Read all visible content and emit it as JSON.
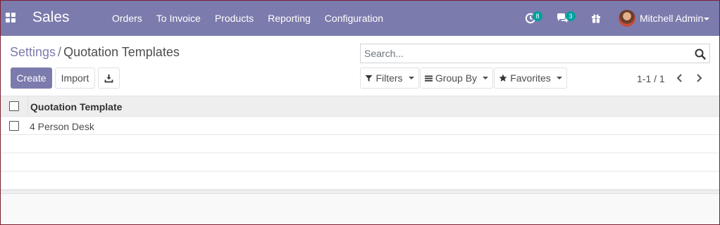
{
  "navbar": {
    "app_name": "Sales",
    "menu": [
      "Orders",
      "To Invoice",
      "Products",
      "Reporting",
      "Configuration"
    ],
    "activity_count": "8",
    "message_count": "3",
    "user_name": "Mitchell Admin",
    "bg_color": "#7c7bad",
    "badge_color": "#00a09d",
    "icons": [
      "apps-grid-icon",
      "activity-clock-icon",
      "chat-bubbles-icon",
      "gift-icon",
      "user-caret-icon"
    ]
  },
  "breadcrumb": {
    "parent": "Settings",
    "separator": "/",
    "current": "Quotation Templates"
  },
  "buttons": {
    "create": "Create",
    "import": "Import"
  },
  "search": {
    "placeholder": "Search...",
    "value": ""
  },
  "filters": {
    "filters_label": "Filters",
    "group_by_label": "Group By",
    "favorites_label": "Favorites"
  },
  "pager": {
    "value": "1-1 / 1"
  },
  "list": {
    "columns": [
      "Quotation Template"
    ],
    "rows": [
      "4 Person Desk"
    ]
  }
}
